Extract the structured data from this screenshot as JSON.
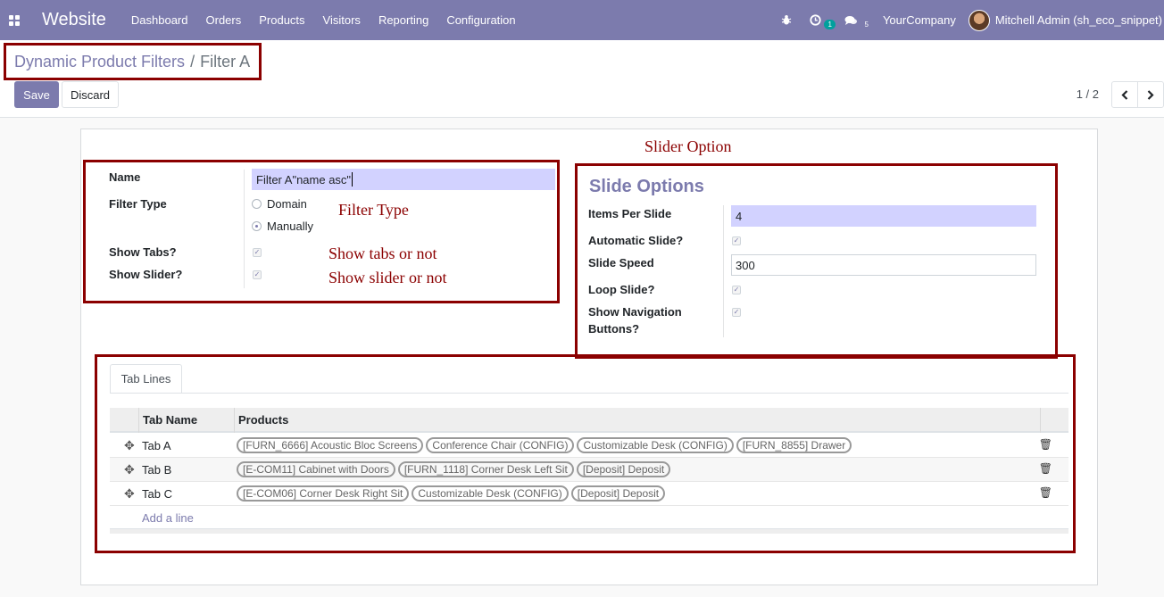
{
  "navbar": {
    "app_name": "Website",
    "menu": [
      "Dashboard",
      "Orders",
      "Products",
      "Visitors",
      "Reporting",
      "Configuration"
    ],
    "activity_count": "1",
    "message_count": "5",
    "company": "YourCompany",
    "user": "Mitchell Admin (sh_eco_snippet)"
  },
  "breadcrumb": {
    "parent": "Dynamic Product Filters",
    "separator": "/",
    "current": "Filter A"
  },
  "actions": {
    "save_label": "Save",
    "discard_label": "Discard"
  },
  "pager": {
    "value": "1 / 2"
  },
  "annotations": {
    "slider_option": "Slider Option",
    "filter_type": "Filter Type",
    "show_tabs": "Show tabs or not",
    "show_slider": "Show slider or not"
  },
  "form": {
    "name_label": "Name",
    "name_value": "Filter A\"name asc\"",
    "filter_type_label": "Filter Type",
    "filter_type_options": [
      "Domain",
      "Manually"
    ],
    "filter_type_selected": "Manually",
    "show_tabs_label": "Show Tabs?",
    "show_tabs_checked": true,
    "show_slider_label": "Show Slider?",
    "show_slider_checked": true
  },
  "slide_options": {
    "title": "Slide Options",
    "items_per_slide_label": "Items Per Slide",
    "items_per_slide_value": "4",
    "automatic_slide_label": "Automatic Slide?",
    "automatic_slide_checked": true,
    "slide_speed_label": "Slide Speed",
    "slide_speed_value": "300",
    "loop_slide_label": "Loop Slide?",
    "loop_slide_checked": true,
    "show_nav_label_line1": "Show Navigation",
    "show_nav_label_line2": "Buttons?",
    "show_nav_checked": true
  },
  "tab_lines": {
    "tab_label": "Tab Lines",
    "columns": [
      "Tab Name",
      "Products"
    ],
    "rows": [
      {
        "name": "Tab A",
        "products": [
          "[FURN_6666] Acoustic Bloc Screens",
          "Conference Chair (CONFIG)",
          "Customizable Desk (CONFIG)",
          "[FURN_8855] Drawer"
        ]
      },
      {
        "name": "Tab B",
        "products": [
          "[E-COM11] Cabinet with Doors",
          "[FURN_1118] Corner Desk Left Sit",
          "[Deposit] Deposit"
        ]
      },
      {
        "name": "Tab C",
        "products": [
          "[E-COM06] Corner Desk Right Sit",
          "Customizable Desk (CONFIG)",
          "[Deposit] Deposit"
        ]
      }
    ],
    "add_line_label": "Add a line"
  },
  "colors": {
    "brand": "#7c7bad",
    "annotation": "#8b0000"
  }
}
